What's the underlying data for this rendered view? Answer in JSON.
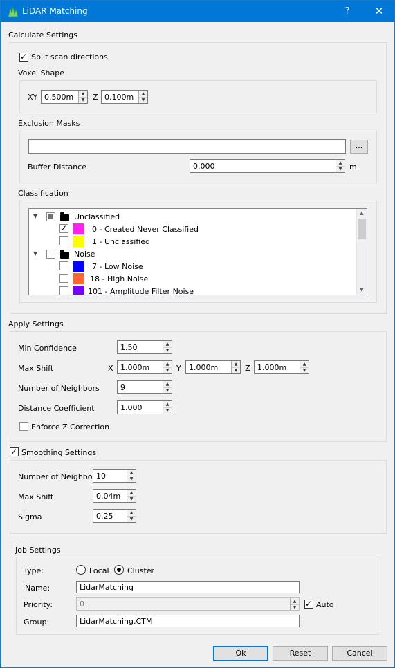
{
  "window": {
    "title": "LiDAR Matching",
    "help": "?",
    "close": "✕"
  },
  "calc": {
    "title": "Calculate Settings",
    "split_label": "Split scan directions",
    "split_checked": true,
    "voxel_title": "Voxel Shape",
    "xy_label": "XY",
    "xy_value": "0.500m",
    "z_label": "Z",
    "z_value": "0.100m",
    "excl_title": "Exclusion Masks",
    "excl_value": "",
    "browse_label": "...",
    "buffer_label": "Buffer Distance",
    "buffer_value": "0.000",
    "buffer_unit": "m",
    "class_title": "Classification",
    "tree": [
      {
        "type": "group",
        "label": "Unclassified",
        "state": "partial"
      },
      {
        "type": "item",
        "label": "0 - Created Never Classified",
        "checked": true,
        "color": "#ff22ee"
      },
      {
        "type": "item",
        "label": "1 - Unclassified",
        "checked": false,
        "color": "#ffff00"
      },
      {
        "type": "group",
        "label": "Noise",
        "state": "unchecked"
      },
      {
        "type": "item",
        "label": "7 - Low Noise",
        "checked": false,
        "color": "#0000ff"
      },
      {
        "type": "item",
        "label": "18 - High Noise",
        "checked": false,
        "color": "#ff6633"
      },
      {
        "type": "item",
        "label": "101 - Amplitude Filter Noise",
        "checked": false,
        "color": "#7700ff"
      }
    ]
  },
  "apply": {
    "title": "Apply Settings",
    "min_conf_label": "Min Confidence",
    "min_conf_value": "1.50",
    "max_shift_label": "Max Shift",
    "x_label": "X",
    "x_value": "1.000m",
    "y_label": "Y",
    "y_value": "1.000m",
    "z_label": "Z",
    "z_value": "1.000m",
    "neighbors_label": "Number of Neighbors",
    "neighbors_value": "9",
    "dist_coef_label": "Distance Coefficient",
    "dist_coef_value": "1.000",
    "enforce_label": "Enforce Z Correction",
    "enforce_checked": false
  },
  "smooth": {
    "title": "Smoothing Settings",
    "checked": true,
    "neighbors_label": "Number of Neighbors",
    "neighbors_value": "10",
    "max_shift_label": "Max Shift",
    "max_shift_value": "0.04m",
    "sigma_label": "Sigma",
    "sigma_value": "0.25"
  },
  "job": {
    "title": "Job Settings",
    "type_label": "Type:",
    "local_label": "Local",
    "cluster_label": "Cluster",
    "selected": "Cluster",
    "name_label": "Name:",
    "name_value": "LidarMatching",
    "priority_label": "Priority:",
    "priority_value": "0",
    "auto_label": "Auto",
    "auto_checked": true,
    "group_label": "Group:",
    "group_value": "LidarMatching.CTM"
  },
  "buttons": {
    "ok": "Ok",
    "reset": "Reset",
    "cancel": "Cancel"
  },
  "colors": {
    "titlebar": "#0078d7",
    "default_border": "#0078d7"
  }
}
